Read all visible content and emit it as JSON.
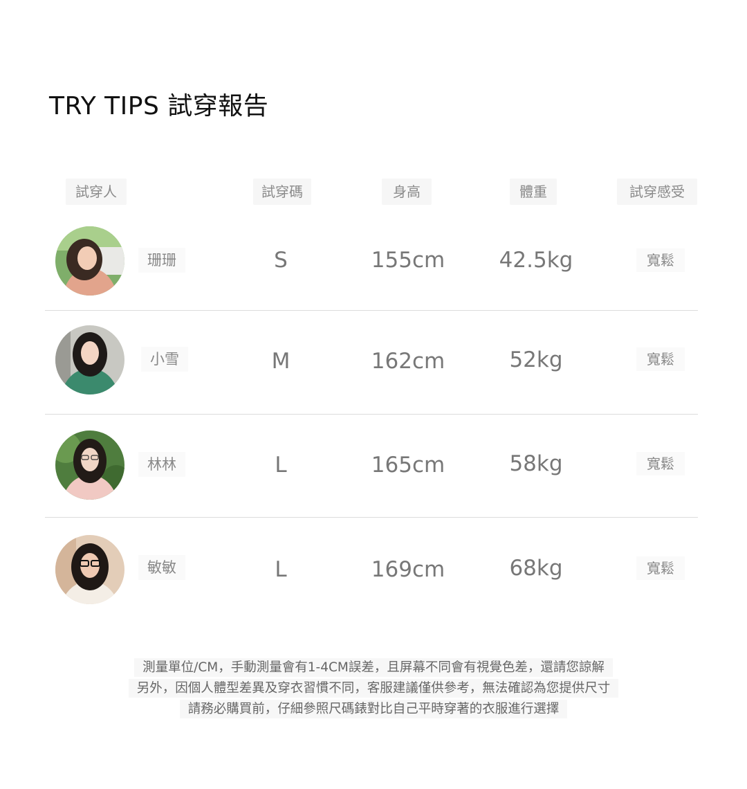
{
  "title": "TRY TIPS 試穿報告",
  "headers": {
    "person": "試穿人",
    "size": "試穿碼",
    "height": "身高",
    "weight": "體重",
    "feel": "試穿感受"
  },
  "rows": [
    {
      "name": "珊珊",
      "size": "S",
      "height": "155cm",
      "weight": "42.5kg",
      "feel": "寬鬆"
    },
    {
      "name": "小雪",
      "size": "M",
      "height": "162cm",
      "weight": "52kg",
      "feel": "寬鬆"
    },
    {
      "name": "林林",
      "size": "L",
      "height": "165cm",
      "weight": "58kg",
      "feel": "寬鬆"
    },
    {
      "name": "敏敏",
      "size": "L",
      "height": "169cm",
      "weight": "68kg",
      "feel": "寬鬆"
    }
  ],
  "notes": [
    "測量單位/CM，手動測量會有1-4CM誤差，且屏幕不同會有視覺色差，還請您諒解",
    "另外，因個人體型差異及穿衣習慣不同，客服建議僅供參考，無法確認為您提供尺寸",
    "請務必購買前，仔細參照尺碼錶對比自己平時穿著的衣服進行選擇"
  ]
}
